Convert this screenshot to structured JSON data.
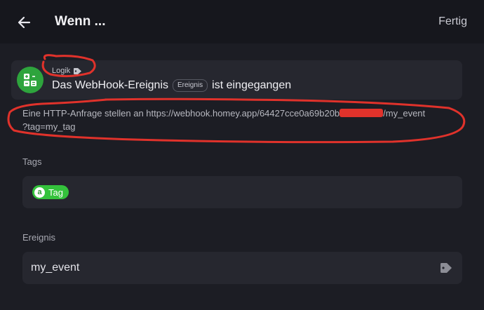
{
  "header": {
    "title": "Wenn ...",
    "done_label": "Fertig",
    "back_icon": "arrow-left-icon"
  },
  "card": {
    "category": "Logik",
    "text_before": "Das WebHook-Ereignis",
    "pill": "Ereignis",
    "text_after": "ist eingegangen",
    "icon": "logic-calculator-icon",
    "icon_color": "#2ea43d"
  },
  "description": {
    "prefix": "Eine HTTP-Anfrage stellen an https://webhook.homey.app/64427cce0a69b20b",
    "suffix": "/my_event",
    "line2": "?tag=my_tag"
  },
  "tags_section": {
    "label": "Tags",
    "chip_icon": "a",
    "chip_label": "Tag",
    "chip_color": "#34c23c"
  },
  "event_section": {
    "label": "Ereignis",
    "value": "my_event"
  },
  "annotations": {
    "color": "#e0322b"
  }
}
